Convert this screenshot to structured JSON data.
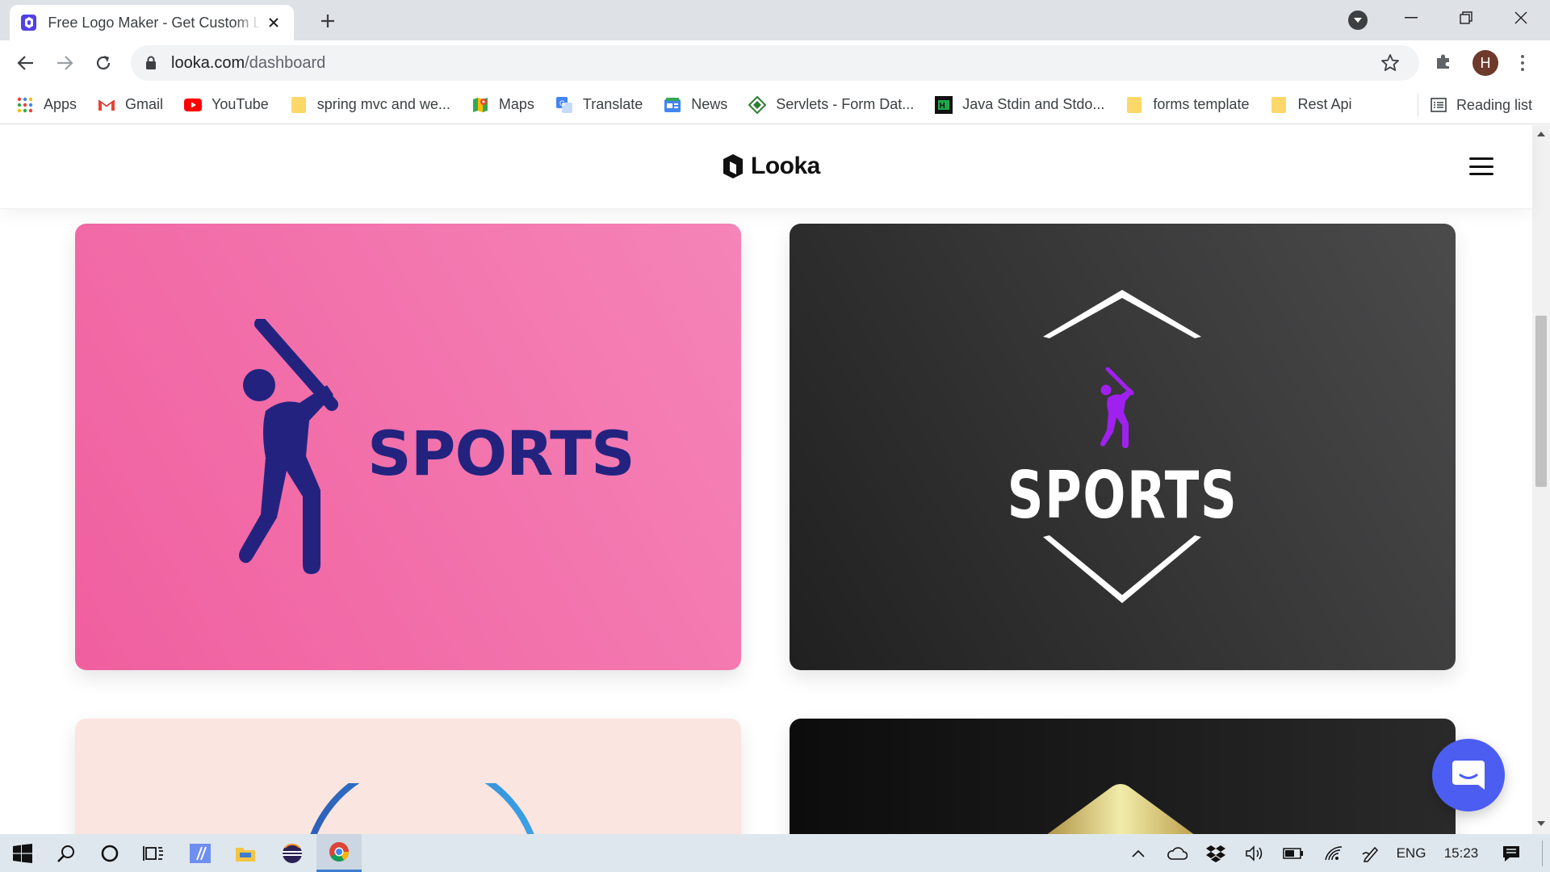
{
  "browser": {
    "tab": {
      "title": "Free Logo Maker - Get Custom Logo Designs in Minutes | Looka",
      "favicon": "looka-icon"
    },
    "address": {
      "domain": "looka.com",
      "path": "/dashboard"
    },
    "profile_initial": "H",
    "bookmarks": [
      {
        "label": "Apps",
        "icon": "apps-grid-icon"
      },
      {
        "label": "Gmail",
        "icon": "gmail-icon"
      },
      {
        "label": "YouTube",
        "icon": "youtube-icon"
      },
      {
        "label": "spring mvc and we...",
        "icon": "folder-icon"
      },
      {
        "label": "Maps",
        "icon": "maps-icon"
      },
      {
        "label": "Translate",
        "icon": "translate-icon"
      },
      {
        "label": "News",
        "icon": "news-icon"
      },
      {
        "label": "Servlets - Form Dat...",
        "icon": "servlets-icon"
      },
      {
        "label": "Java Stdin and Stdo...",
        "icon": "hackerrank-icon"
      },
      {
        "label": "forms template",
        "icon": "folder-icon"
      },
      {
        "label": "Rest Api",
        "icon": "folder-icon"
      }
    ],
    "reading_list": "Reading list"
  },
  "page": {
    "brand": "Looka",
    "cards": [
      {
        "logo_text": "SPORTS",
        "text_color": "#23237f",
        "icon": "baseball-batter-icon"
      },
      {
        "logo_text": "SPORTS",
        "text_color": "#ffffff",
        "icon": "baseball-batter-icon",
        "icon_color": "#a020f0"
      }
    ]
  },
  "taskbar": {
    "language": "ENG",
    "time": "15:23"
  },
  "colors": {
    "accent": "#4c5df2",
    "card_pink": "#f05f9f",
    "card_dark": "#2a2a2a"
  }
}
